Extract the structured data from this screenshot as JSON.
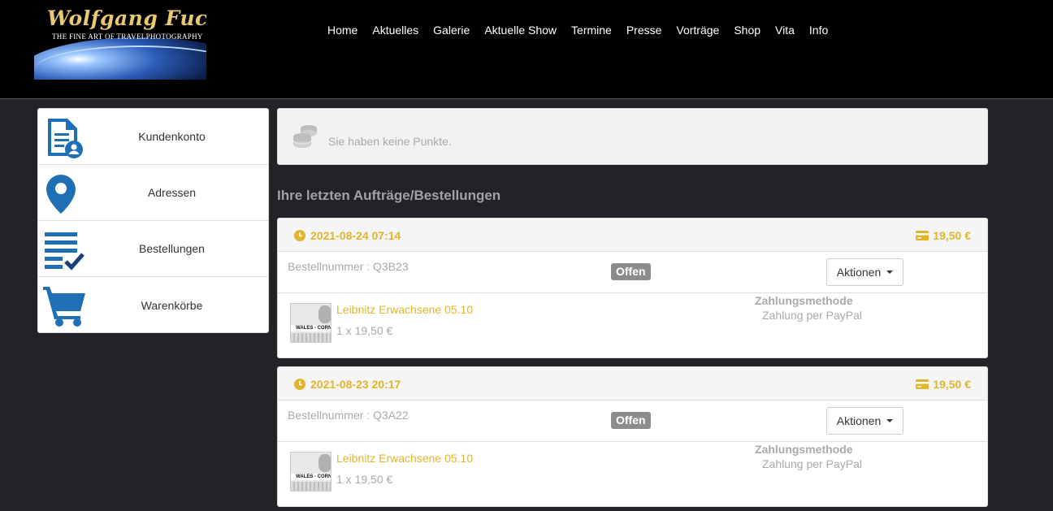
{
  "brand": {
    "name": "Wolfgang Fuchs",
    "tagline": "THE FINE ART OF TRAVELPHOTOGRAPHY"
  },
  "nav": [
    "Home",
    "Aktuelles",
    "Galerie",
    "Aktuelle Show",
    "Termine",
    "Presse",
    "Vorträge",
    "Shop",
    "Vita",
    "Info"
  ],
  "sidebar": {
    "items": [
      {
        "label": "Kundenkonto",
        "icon": "account-document-icon"
      },
      {
        "label": "Adressen",
        "icon": "map-pin-icon"
      },
      {
        "label": "Bestellungen",
        "icon": "order-list-check-icon"
      },
      {
        "label": "Warenkörbe",
        "icon": "shopping-cart-icon"
      }
    ]
  },
  "points": {
    "text": "Sie haben keine Punkte.",
    "icon": "coins-icon"
  },
  "orders_title": "Ihre letzten Aufträge/Bestellungen",
  "orders": [
    {
      "datetime": "2021-08-24 07:14",
      "total": "19,50 €",
      "number": "Bestellnummer : Q3B23",
      "status": "Offen",
      "actions_label": "Aktionen",
      "item_title": "Leibnitz Erwachsene 05.10",
      "item_qty": "1 x 19,50 €",
      "thumb_text": "WALES - CORNW",
      "payment_label": "Zahlungsmethode",
      "payment_value": "Zahlung per PayPal"
    },
    {
      "datetime": "2021-08-23 20:17",
      "total": "19,50 €",
      "number": "Bestellnummer : Q3A22",
      "status": "Offen",
      "actions_label": "Aktionen",
      "item_title": "Leibnitz Erwachsene 05.10",
      "item_qty": "1 x 19,50 €",
      "thumb_text": "WALES - CORNW",
      "payment_label": "Zahlungsmethode",
      "payment_value": "Zahlung per PayPal"
    }
  ],
  "colors": {
    "accent": "#e0b52b",
    "icon_blue": "#1f6fb5",
    "badge": "#8c8c8c",
    "page_bg": "#222328",
    "header_bg": "#000000"
  }
}
